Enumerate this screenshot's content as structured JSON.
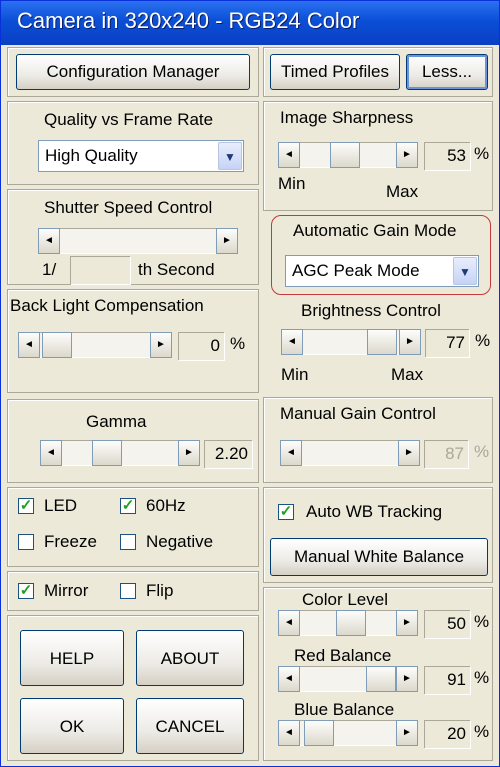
{
  "window": {
    "title": "Camera in 320x240 - RGB24 Color"
  },
  "top_buttons": {
    "config": "Configuration Manager",
    "timed": "Timed Profiles",
    "less": "Less..."
  },
  "quality": {
    "label": "Quality vs Frame Rate",
    "value": "High Quality"
  },
  "shutter": {
    "label": "Shutter Speed Control",
    "prefix": "1/",
    "value": "",
    "suffix": "th Second"
  },
  "backlight": {
    "label": "Back Light Compensation",
    "value": "0",
    "unit": "%"
  },
  "gamma": {
    "label": "Gamma",
    "value": "2.20"
  },
  "checks": {
    "led": {
      "label": "LED",
      "checked": true
    },
    "hz60": {
      "label": "60Hz",
      "checked": true
    },
    "freeze": {
      "label": "Freeze",
      "checked": false
    },
    "negative": {
      "label": "Negative",
      "checked": false
    },
    "mirror": {
      "label": "Mirror",
      "checked": true
    },
    "flip": {
      "label": "Flip",
      "checked": false
    }
  },
  "bottom_buttons": {
    "help": "HELP",
    "about": "ABOUT",
    "ok": "OK",
    "cancel": "CANCEL"
  },
  "sharpness": {
    "label": "Image Sharpness",
    "value": "53",
    "unit": "%",
    "min": "Min",
    "max": "Max"
  },
  "agc": {
    "label": "Automatic Gain Mode",
    "value": "AGC Peak Mode"
  },
  "brightness": {
    "label": "Brightness Control",
    "value": "77",
    "unit": "%",
    "min": "Min",
    "max": "Max"
  },
  "manual_gain": {
    "label": "Manual Gain Control",
    "value": "87",
    "unit": "%"
  },
  "awb": {
    "label": "Auto WB Tracking",
    "checked": true,
    "manual_wb": "Manual White Balance"
  },
  "color_level": {
    "label": "Color Level",
    "value": "50",
    "unit": "%"
  },
  "red_balance": {
    "label": "Red Balance",
    "value": "91",
    "unit": "%"
  },
  "blue_balance": {
    "label": "Blue Balance",
    "value": "20",
    "unit": "%"
  },
  "glyphs": {
    "left": "◄",
    "right": "►",
    "down": "▼",
    "check": "✓"
  },
  "colors": {
    "title_bar": "#0a4fd6",
    "highlight_ring": "#c23a3a",
    "face": "#ece9d8"
  }
}
